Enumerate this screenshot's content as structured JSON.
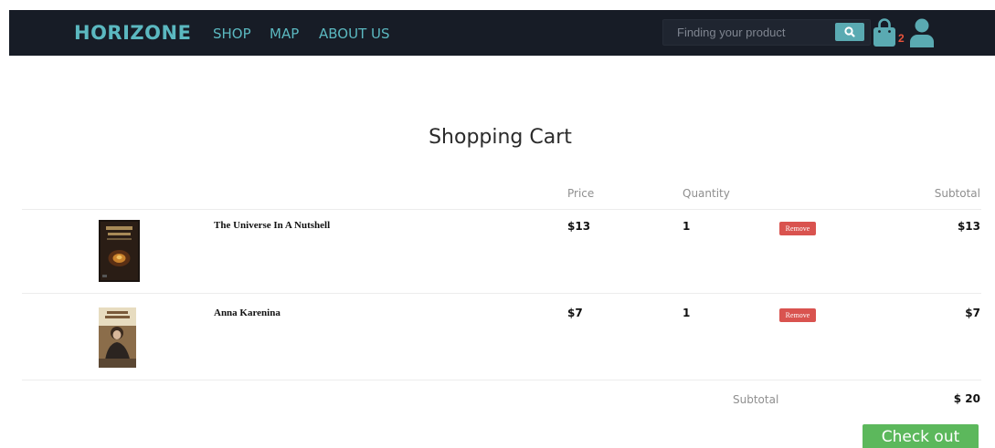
{
  "nav": {
    "brand": "HORIZONE",
    "links": [
      "SHOP",
      "MAP",
      "ABOUT US"
    ],
    "search_placeholder": "Finding your product",
    "cart_count": "2",
    "icons": [
      "search-icon",
      "shopping-bag-icon",
      "user-icon"
    ]
  },
  "page": {
    "title": "Shopping Cart"
  },
  "table": {
    "headers": {
      "price": "Price",
      "quantity": "Quantity",
      "subtotal": "Subtotal"
    },
    "rows": [
      {
        "name": "The Universe In A Nutshell",
        "price": "$13",
        "quantity": "1",
        "remove_label": "Remove",
        "subtotal": "$13"
      },
      {
        "name": "Anna Karenina",
        "price": "$7",
        "quantity": "1",
        "remove_label": "Remove",
        "subtotal": "$7"
      }
    ]
  },
  "summary": {
    "subtotal_label": "Subtotal",
    "total": "$ 20"
  },
  "checkout": {
    "label": "Check out"
  },
  "colors": {
    "navbar": "#171c26",
    "accent": "#5bb8c0",
    "remove": "#d9534f",
    "checkout": "#5cb85c",
    "badge": "#e8533b"
  }
}
